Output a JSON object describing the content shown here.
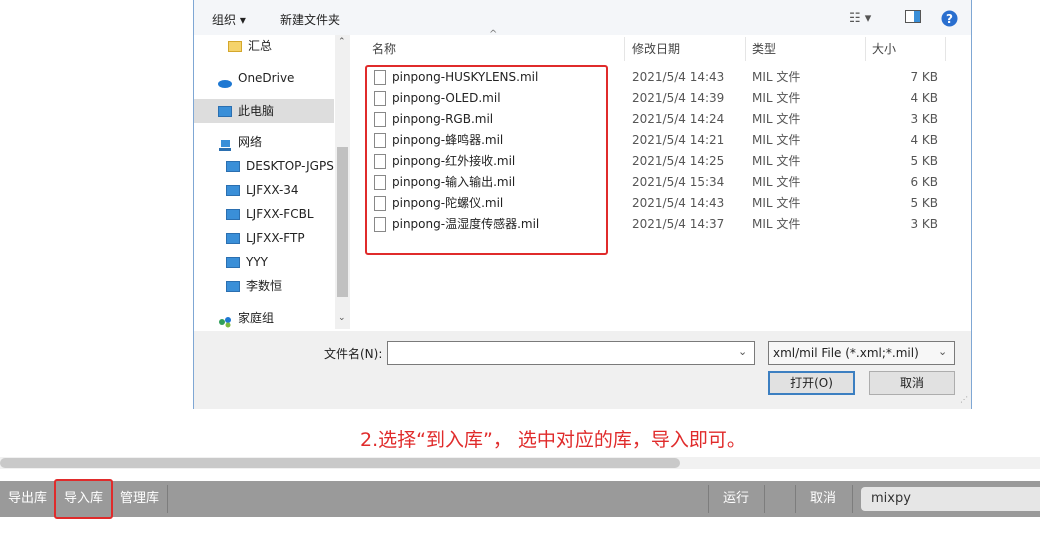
{
  "toolbar": {
    "organize": "组织 ▾",
    "new_folder": "新建文件夹"
  },
  "nav": {
    "items": [
      {
        "label": "汇总",
        "icon": "folder-icon"
      },
      {
        "label": "OneDrive",
        "icon": "cloud-icon"
      },
      {
        "label": "此电脑",
        "icon": "computer-icon",
        "selected": true
      },
      {
        "label": "网络",
        "icon": "network-icon"
      },
      {
        "label": "DESKTOP-JGPS",
        "icon": "computer-icon"
      },
      {
        "label": "LJFXX-34",
        "icon": "computer-icon"
      },
      {
        "label": "LJFXX-FCBL",
        "icon": "computer-icon"
      },
      {
        "label": "LJFXX-FTP",
        "icon": "computer-icon"
      },
      {
        "label": "YYY",
        "icon": "computer-icon"
      },
      {
        "label": "李数恒",
        "icon": "computer-icon"
      },
      {
        "label": "家庭组",
        "icon": "homegroup-icon"
      }
    ]
  },
  "columns": {
    "name": "名称",
    "date": "修改日期",
    "type": "类型",
    "size": "大小"
  },
  "files": [
    {
      "name": "pinpong-HUSKYLENS.mil",
      "date": "2021/5/4 14:43",
      "type": "MIL 文件",
      "size": "7 KB"
    },
    {
      "name": "pinpong-OLED.mil",
      "date": "2021/5/4 14:39",
      "type": "MIL 文件",
      "size": "4 KB"
    },
    {
      "name": "pinpong-RGB.mil",
      "date": "2021/5/4 14:24",
      "type": "MIL 文件",
      "size": "3 KB"
    },
    {
      "name": "pinpong-蜂鸣器.mil",
      "date": "2021/5/4 14:21",
      "type": "MIL 文件",
      "size": "4 KB"
    },
    {
      "name": "pinpong-红外接收.mil",
      "date": "2021/5/4 14:25",
      "type": "MIL 文件",
      "size": "5 KB"
    },
    {
      "name": "pinpong-输入输出.mil",
      "date": "2021/5/4 15:34",
      "type": "MIL 文件",
      "size": "6 KB"
    },
    {
      "name": "pinpong-陀螺仪.mil",
      "date": "2021/5/4 14:43",
      "type": "MIL 文件",
      "size": "5 KB"
    },
    {
      "name": "pinpong-温湿度传感器.mil",
      "date": "2021/5/4 14:37",
      "type": "MIL 文件",
      "size": "3 KB"
    }
  ],
  "filename": {
    "label": "文件名(N):",
    "value": ""
  },
  "filter": {
    "value": "xml/mil File (*.xml;*.mil)"
  },
  "buttons": {
    "open": "打开(O)",
    "cancel": "取消"
  },
  "caption": "2.选择“到入库”， 选中对应的库，导入即可。",
  "statusbar": {
    "export": "导出库",
    "import": "导入库",
    "manage": "管理库",
    "run": "运行",
    "cancel": "取消",
    "search": "mixpy"
  },
  "colors": {
    "highlight": "#e02b2b",
    "statusbar": "#9a9a9a"
  }
}
